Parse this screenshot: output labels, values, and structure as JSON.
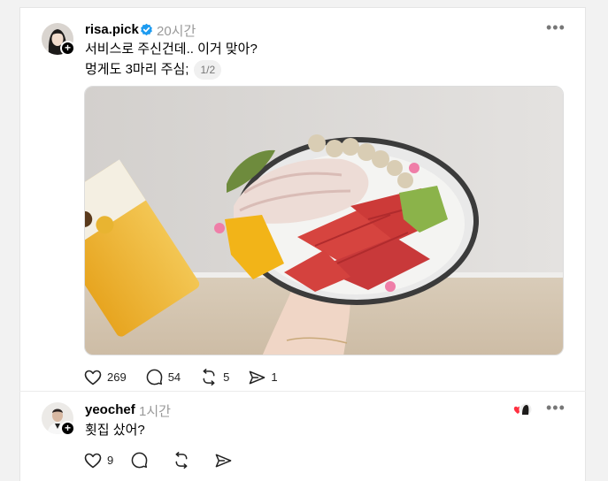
{
  "post": {
    "username": "risa.pick",
    "time": "20시간",
    "line1": "서비스로 주신건데.. 이거 맞아?",
    "line2": "멍게도 3마리 주심;",
    "page_indicator": "1/2",
    "photo_description_icon": "sashimi-platter-photo",
    "stats": {
      "likes": "269",
      "comments": "54",
      "reposts": "5",
      "shares": "1"
    }
  },
  "reply": {
    "username": "yeochef",
    "time": "1시간",
    "text": "횟집 샀어?",
    "stats": {
      "likes": "9"
    }
  },
  "colors": {
    "verified": "#1d9bf0",
    "heart_red": "#ff3040",
    "muted": "#999999"
  }
}
